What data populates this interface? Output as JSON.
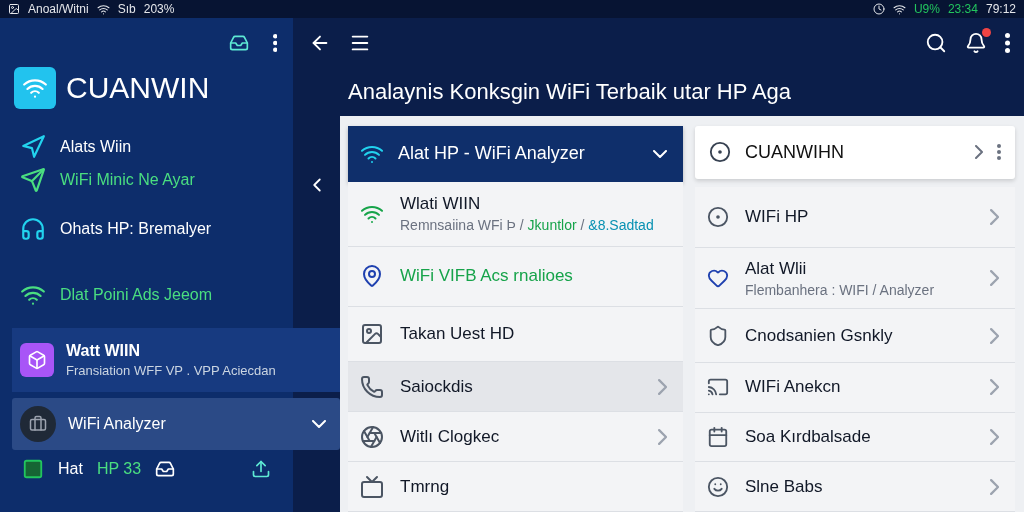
{
  "status_bar": {
    "left_text": "Anoal/Witni",
    "signal_text": "Sıb",
    "battery_text": "203%",
    "right_texts": [
      {
        "text": "U9%",
        "color": "#22c55e"
      },
      {
        "text": "23:34",
        "color": "#22c55e"
      },
      {
        "text": "79:12",
        "color": "#e5e7eb"
      }
    ]
  },
  "drawer": {
    "brand": "CUANWIN",
    "items": [
      {
        "kind": "plain",
        "label": "Alats Wiin",
        "color": "#ffffff"
      },
      {
        "kind": "plain",
        "label": "WiFi Minic Ne Ayar",
        "color": "#4ade80"
      },
      {
        "kind": "plain",
        "label": "Ohats HP: Bremalyer",
        "color": "#ffffff"
      },
      {
        "kind": "plain",
        "label": "Dlat Poini Ads Jeeom",
        "color": "#4ade80"
      },
      {
        "kind": "card",
        "label": "Watt WIIN",
        "subtitle": "Fransiation WFF VP . VPP Aciecdan",
        "color": "#ffffff"
      },
      {
        "kind": "dropdown",
        "label": "WiFi Analyzer",
        "color": "#ffffff",
        "expanded": false
      },
      {
        "kind": "footer",
        "label": "Hat",
        "extra": "HP 33",
        "color": "#ffffff"
      }
    ]
  },
  "toolbar": {
    "notification_badge": true
  },
  "title": "Analaynis Konksgin WiFi Terbaik utar HP Aga",
  "left_list": {
    "header": "Alat HP - WiFi Analyzer",
    "expanded": false,
    "rows": [
      {
        "title": "Wlati WIIN",
        "subtitle_parts": [
          {
            "text": "Remnsaiina WFi Þ / ",
            "color": "#6b7280"
          },
          {
            "text": "Jkuntlor",
            "color": "#16a34a"
          },
          {
            "text": " / ",
            "color": "#6b7280"
          },
          {
            "text": "&8.Sadtad",
            "color": "#0891b2"
          }
        ],
        "color": "#111827",
        "selected": false,
        "chevron": false
      },
      {
        "title": "WiFi VIFB Acs rnalioes",
        "color": "#16a34a",
        "selected": false,
        "chevron": false
      },
      {
        "title": "Takan Uest HD",
        "color": "#111827",
        "selected": false,
        "chevron": false
      },
      {
        "title": "Saiockdis",
        "color": "#111827",
        "selected": true,
        "chevron": true
      },
      {
        "title": "Witlı Clogkec",
        "color": "#111827",
        "selected": false,
        "chevron": true
      },
      {
        "title": "Tmrng",
        "color": "#111827",
        "selected": false,
        "chevron": false
      }
    ]
  },
  "right_list": {
    "header": "CUANWIHN",
    "rows": [
      {
        "title": "WIFi HP"
      },
      {
        "title": "Alat Wlii",
        "subtitle": "Flembanhera : WIFI / Analyzer"
      },
      {
        "title": "Cnodsanien Gsnkly"
      },
      {
        "title": "WIFi Anekcn"
      },
      {
        "title": "Soa Kırdbalsade"
      },
      {
        "title": "Slne Babs"
      }
    ]
  }
}
